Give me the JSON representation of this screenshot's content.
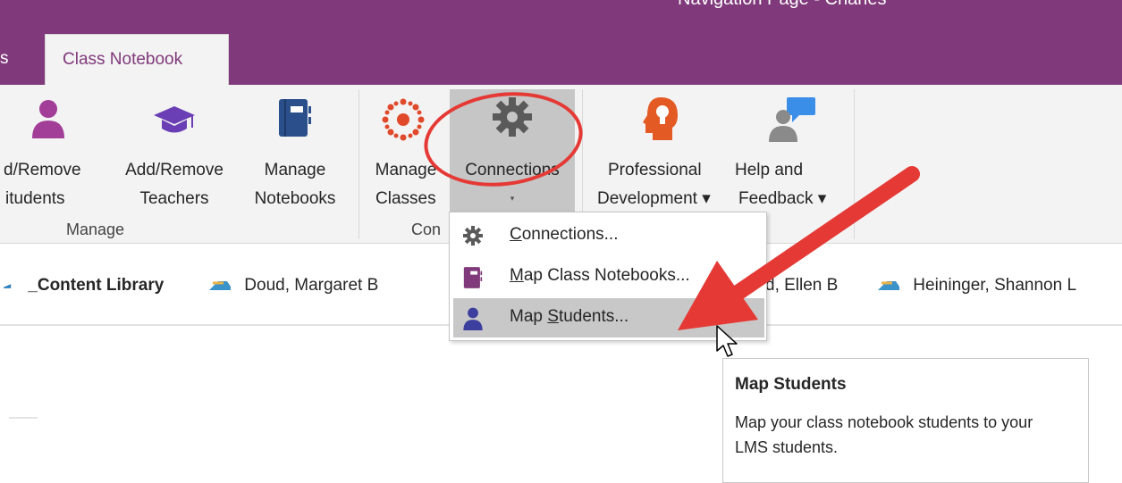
{
  "window": {
    "title": "Navigation Page - Charles",
    "tabs": [
      {
        "label": "s"
      },
      {
        "label": "Class Notebook"
      }
    ]
  },
  "ribbon": {
    "buttons": [
      {
        "label_line1": "d/Remove",
        "label_line2": "itudents",
        "icon": "student-person-icon"
      },
      {
        "label_line1": "Add/Remove",
        "label_line2": "Teachers",
        "icon": "graduation-cap-icon"
      },
      {
        "label_line1": "Manage",
        "label_line2": "Notebooks",
        "icon": "notebook-icon"
      },
      {
        "label_line1": "Manage",
        "label_line2": "Classes",
        "icon": "lms-logo-icon"
      },
      {
        "label_line1": "Connections",
        "label_line2": "▾",
        "icon": "gear-icon"
      },
      {
        "label_line1": "Professional",
        "label_line2": "Development ▾",
        "icon": "lightbulb-head-icon"
      },
      {
        "label_line1": "Help and",
        "label_line2": "Feedback ▾",
        "icon": "speech-person-icon"
      }
    ],
    "groups": [
      {
        "label": "Manage"
      },
      {
        "label": "Con"
      }
    ]
  },
  "notebook_bar": {
    "items": [
      {
        "label": "_Content Library",
        "bold": true
      },
      {
        "label": "Doud, Margaret B"
      },
      {
        "label": "d, Ellen B"
      },
      {
        "label": "Heininger, Shannon L"
      }
    ]
  },
  "dropdown": {
    "items": [
      {
        "label_pre": "",
        "label_u": "C",
        "label_post": "onnections...",
        "icon": "gear-icon"
      },
      {
        "label_pre": "",
        "label_u": "M",
        "label_post": "ap Class Notebooks...",
        "icon": "notebook-icon"
      },
      {
        "label_pre": "Map ",
        "label_u": "S",
        "label_post": "tudents...",
        "icon": "student-person-icon",
        "selected": true
      }
    ]
  },
  "tooltip": {
    "title": "Map Students",
    "body": "Map your class notebook students to your LMS students."
  },
  "colors": {
    "titlebar": "#80397b",
    "ribbon": "#f3f3f3",
    "annotation_red": "#e53935",
    "student_icon_purple": "#a23d98",
    "teacher_icon_purple": "#6a3fb5",
    "notebook_blue": "#2b4f8a",
    "lms_red": "#e0492a",
    "bulb_orange": "#e45a25",
    "help_blue": "#3b8ee8",
    "selected_bg": "#c8c8c8"
  }
}
